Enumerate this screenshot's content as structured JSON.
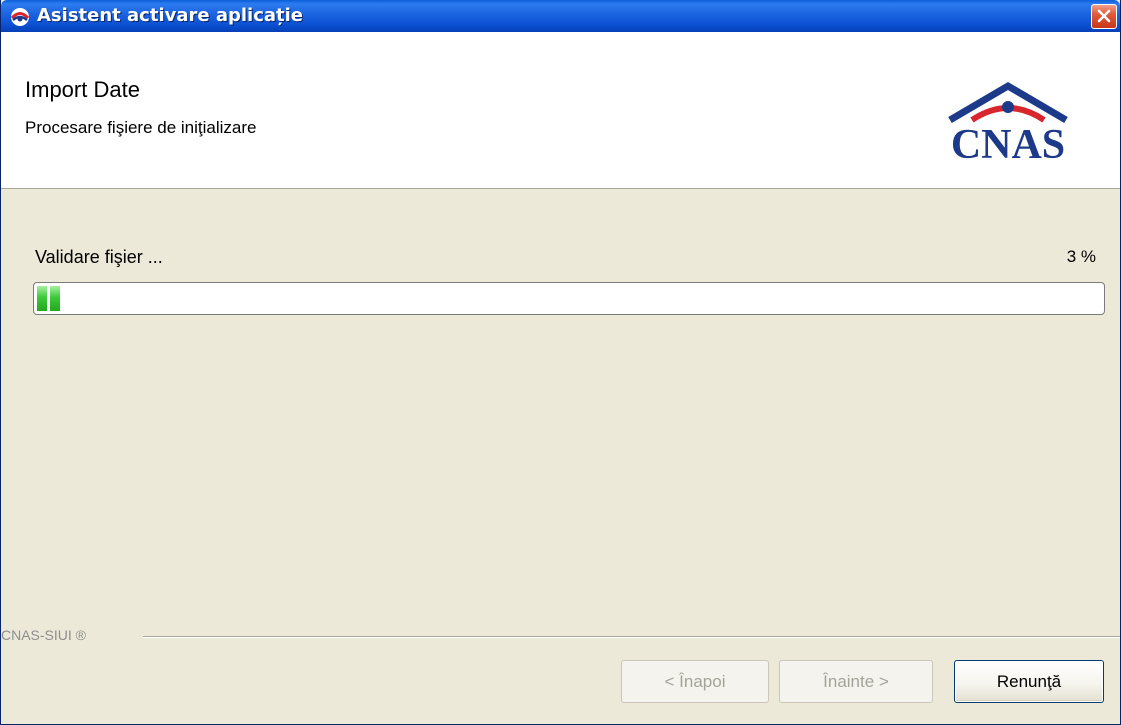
{
  "window": {
    "title": "Asistent activare aplicație",
    "close_label": "×"
  },
  "header": {
    "title": "Import Date",
    "subtitle": "Procesare fişiere de iniţializare",
    "logo_text": "CNAS"
  },
  "progress": {
    "status": "Validare fişier ...",
    "percent_text": "3 %",
    "value": 3,
    "fill_color": "#3EC93C"
  },
  "footer": {
    "brand": "CNAS-SIUI ®",
    "back_button": "< Înapoi",
    "next_button": "Înainte >",
    "cancel_button": "Renunţă"
  },
  "colors": {
    "titlebar": "#1B63E0",
    "background": "#ECE9D8",
    "logo_blue": "#1D3A8A",
    "logo_red": "#D8262E"
  },
  "icons": {
    "title": "cnas-app-icon",
    "close": "close-icon"
  }
}
